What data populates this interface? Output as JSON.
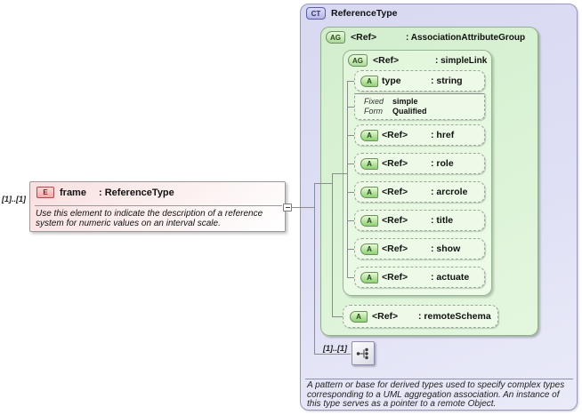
{
  "element": {
    "occurs": "[1]..[1]",
    "badge": "E",
    "name": "frame",
    "type": ": ReferenceType",
    "description": "Use this element to indicate the description of a reference system for numeric values on an interval scale."
  },
  "ct": {
    "badge": "CT",
    "title": "ReferenceType",
    "assoc_group": {
      "badge": "AG",
      "ref": "<Ref>",
      "type": ": AssociationAttributeGroup"
    },
    "simple_link": {
      "badge": "AG",
      "ref": "<Ref>",
      "type": ": simpleLink"
    },
    "attributes": [
      {
        "badge": "A",
        "name": "type",
        "type": ": string"
      },
      {
        "badge": "A",
        "name": "<Ref>",
        "type": ": href"
      },
      {
        "badge": "A",
        "name": "<Ref>",
        "type": ": role"
      },
      {
        "badge": "A",
        "name": "<Ref>",
        "type": ": arcrole"
      },
      {
        "badge": "A",
        "name": "<Ref>",
        "type": ": title"
      },
      {
        "badge": "A",
        "name": "<Ref>",
        "type": ": show"
      },
      {
        "badge": "A",
        "name": "<Ref>",
        "type": ": actuate"
      },
      {
        "badge": "A",
        "name": "<Ref>",
        "type": ": remoteSchema"
      }
    ],
    "type_facets": {
      "rows": [
        {
          "label": "Fixed",
          "value": "simple"
        },
        {
          "label": "Form",
          "value": "Qualified"
        }
      ]
    },
    "compositor_occurs": "[1]..[1]",
    "annotation": "A pattern or base for derived types used to specify complex types corresponding to a UML aggregation association.  An instance of this type serves as a pointer to a remote Object."
  }
}
